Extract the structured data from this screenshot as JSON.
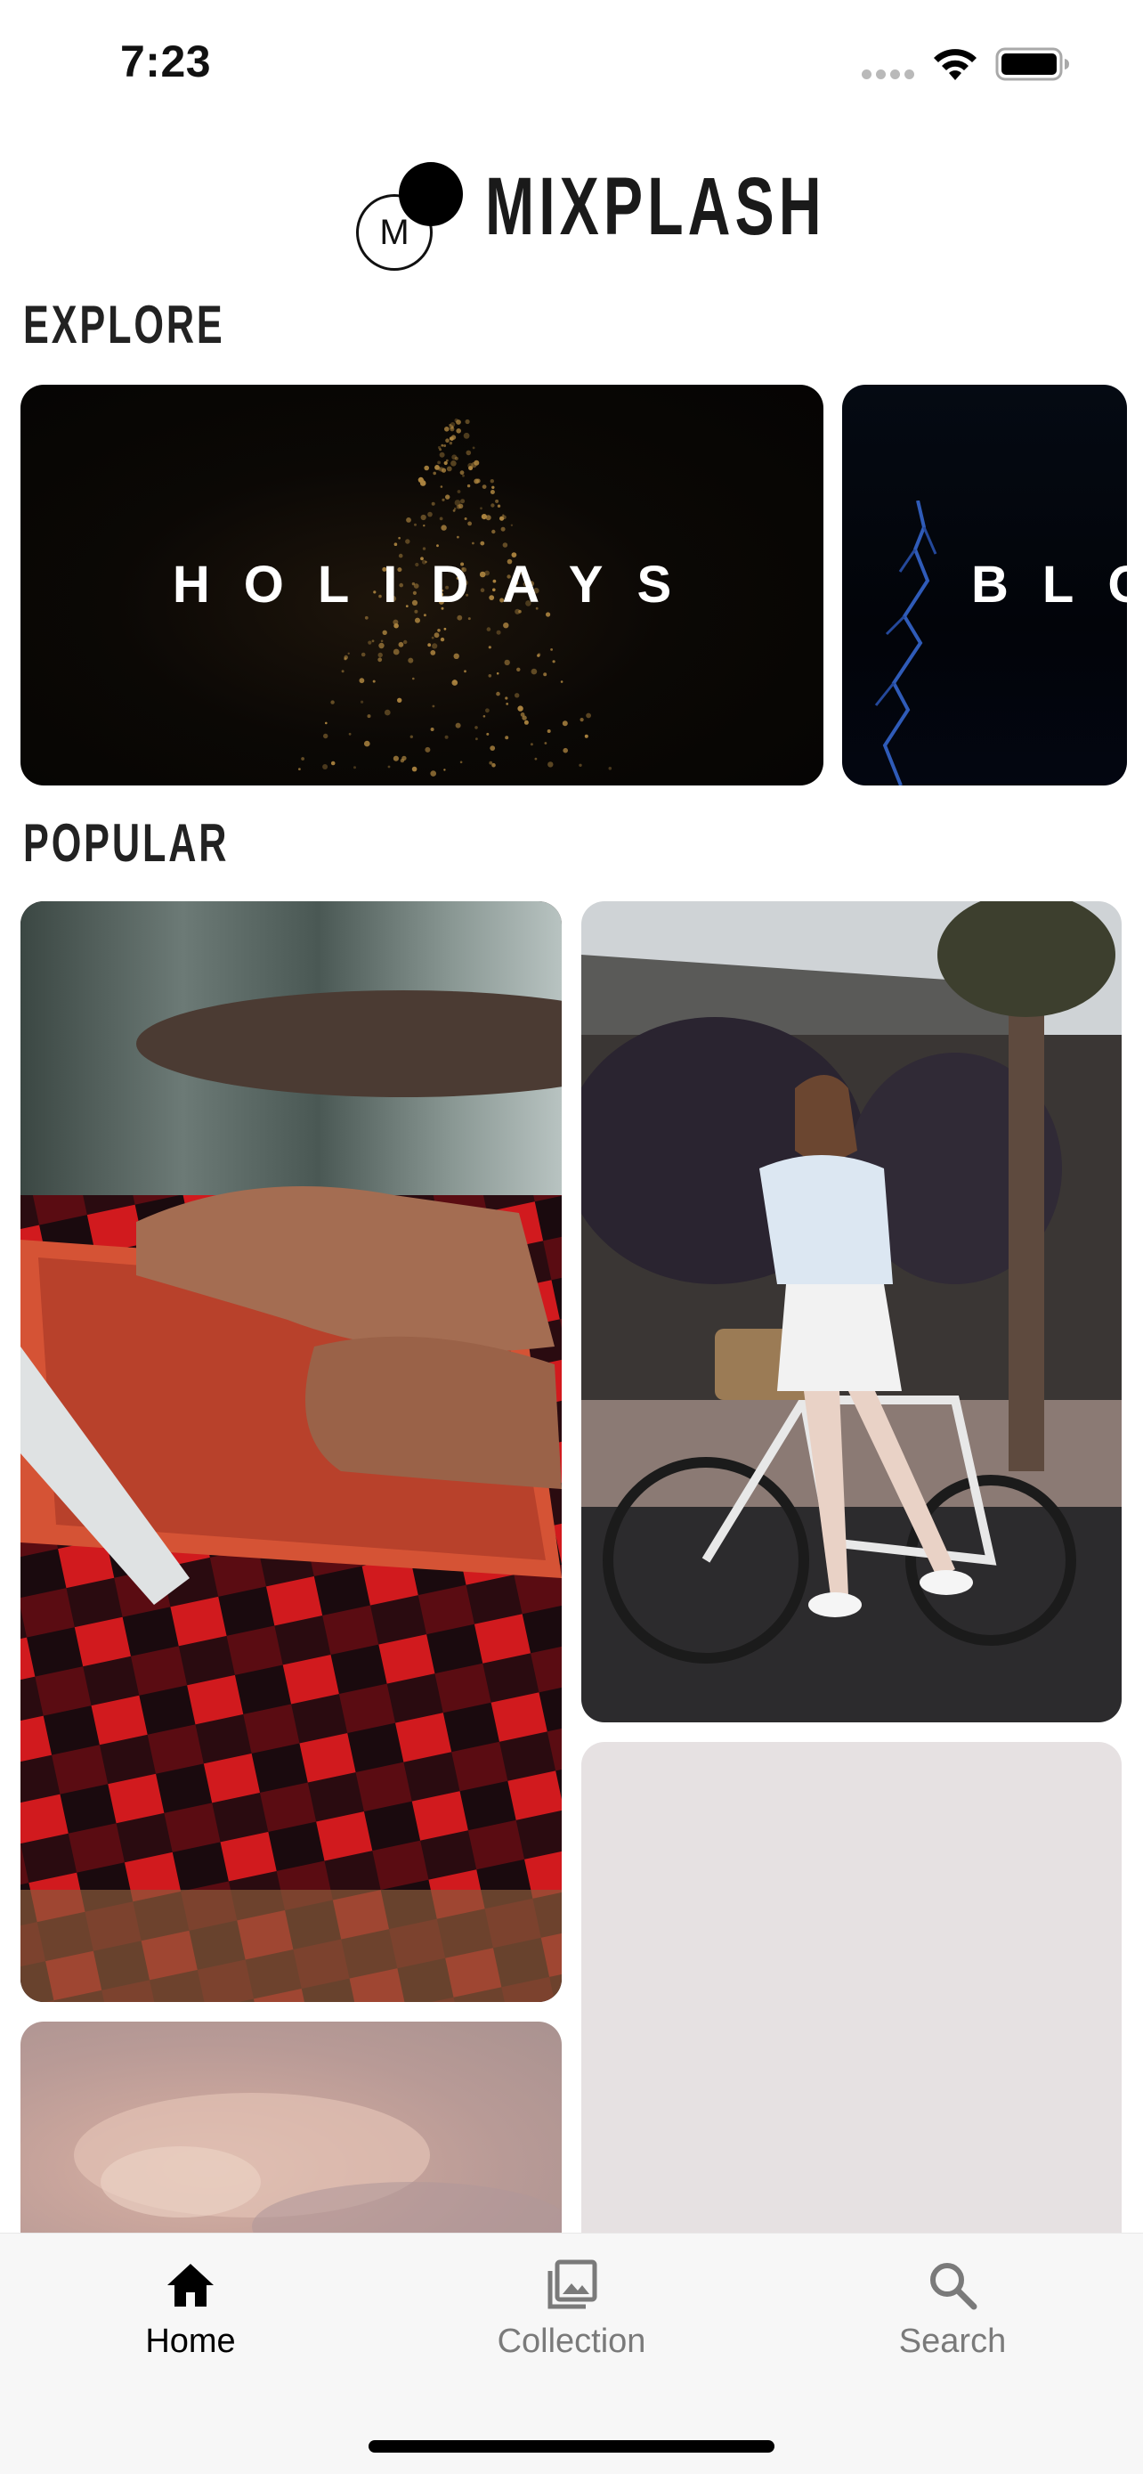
{
  "status_bar": {
    "time": "7:23",
    "icons": [
      "cellular-signal-icon",
      "wifi-icon",
      "battery-icon"
    ]
  },
  "header": {
    "logo_letter": "M",
    "app_title": "MIXPLASH"
  },
  "explore": {
    "title": "EXPLORE",
    "cards": [
      {
        "label": "HOLIDAYS"
      },
      {
        "label": "BLOG"
      }
    ]
  },
  "popular": {
    "title": "POPULAR",
    "photos": [
      {
        "name": "keyboard-photo"
      },
      {
        "name": "bicycle-photo"
      },
      {
        "name": "blank-photo"
      },
      {
        "name": "sky-photo"
      }
    ]
  },
  "tab_bar": {
    "tabs": [
      {
        "label": "Home",
        "icon": "home-icon",
        "active": true
      },
      {
        "label": "Collection",
        "icon": "collection-icon",
        "active": false
      },
      {
        "label": "Search",
        "icon": "search-icon",
        "active": false
      }
    ],
    "active_color": "#000000",
    "inactive_color": "#7a7a7a"
  }
}
